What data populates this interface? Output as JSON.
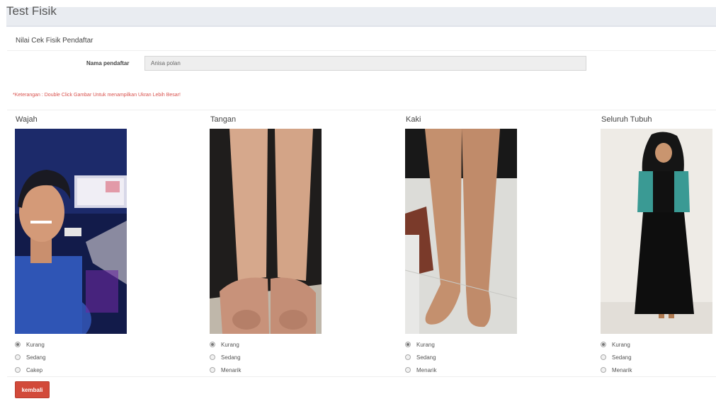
{
  "page": {
    "title": "Test Fisik"
  },
  "section": {
    "title": "Nilai Cek Fisik Pendaftar"
  },
  "form": {
    "name_label": "Nama pendaftar",
    "name_value": "Anisa polan"
  },
  "note": "*Keterangan : Double Click Gambar Untuk menampilkan Ukran Lebih Besar!",
  "columns": [
    {
      "title": "Wajah",
      "options": [
        "Kurang",
        "Sedang",
        "Cakep"
      ],
      "selected": 0
    },
    {
      "title": "Tangan",
      "options": [
        "Kurang",
        "Sedang",
        "Menarik"
      ],
      "selected": 0
    },
    {
      "title": "Kaki",
      "options": [
        "Kurang",
        "Sedang",
        "Menarik"
      ],
      "selected": 0
    },
    {
      "title": "Seluruh Tubuh",
      "options": [
        "Kurang",
        "Sedang",
        "Menarik"
      ],
      "selected": 0
    }
  ],
  "actions": {
    "back_label": "kembali"
  },
  "colors": {
    "accent_red": "#d24a3a",
    "note_red": "#d9534f",
    "header_bg": "#e9ecf1"
  }
}
